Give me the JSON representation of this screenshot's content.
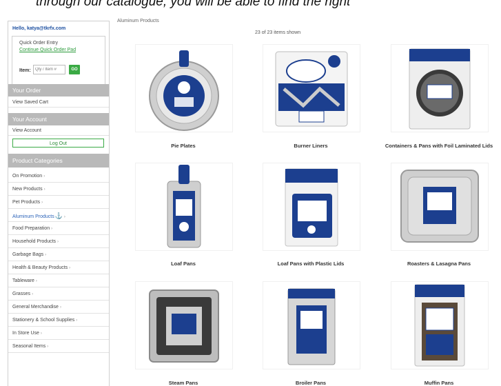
{
  "banner_text": "through our catalogue, you will be able to find the right",
  "sidebar": {
    "email": "Hello, katya@tkrfx.com",
    "quick_order": {
      "title": "Quick Order Entry",
      "link": "Continue Quick Order Pad",
      "item_label": "Item:",
      "input_placeholder": "Qty / Item #",
      "go_label": "GO"
    },
    "your_order_header": "Your Order",
    "view_saved_cart": "View Saved Cart",
    "account_header": "Your Account",
    "view_account": "View Account",
    "log_out": "Log Out",
    "categories_header": "Product Categories",
    "categories": [
      {
        "label": "On Promotion"
      },
      {
        "label": "New Products"
      },
      {
        "label": "Pet Products"
      },
      {
        "label": "Aluminum Products"
      },
      {
        "label": "Food Preparation"
      },
      {
        "label": "Household Products"
      },
      {
        "label": "Garbage Bags"
      },
      {
        "label": "Health & Beauty Products"
      },
      {
        "label": "Tableware"
      },
      {
        "label": "Grasses"
      },
      {
        "label": "General Merchandise"
      },
      {
        "label": "Stationery & School Supplies"
      },
      {
        "label": "In Store Use"
      },
      {
        "label": "Seasonal Items"
      }
    ],
    "arrow": "›"
  },
  "main": {
    "breadcrumb": "Aluminum Products",
    "count_text": "23 of 23 items shown",
    "products": [
      {
        "name": "Pie Plates"
      },
      {
        "name": "Burner Liners"
      },
      {
        "name": "Containers & Pans with Foil Laminated Lids"
      },
      {
        "name": "Loaf Pans"
      },
      {
        "name": "Loaf Pans with Plastic Lids"
      },
      {
        "name": "Roasters & Lasagna Pans"
      },
      {
        "name": "Steam Pans"
      },
      {
        "name": "Broiler Pans"
      },
      {
        "name": "Muffin Pans"
      }
    ]
  },
  "colors": {
    "accent_green": "#3aaa44",
    "link_blue": "#2a62b8",
    "header_gray": "#b9b9b9",
    "brand_blue": "#1c3f8f"
  }
}
